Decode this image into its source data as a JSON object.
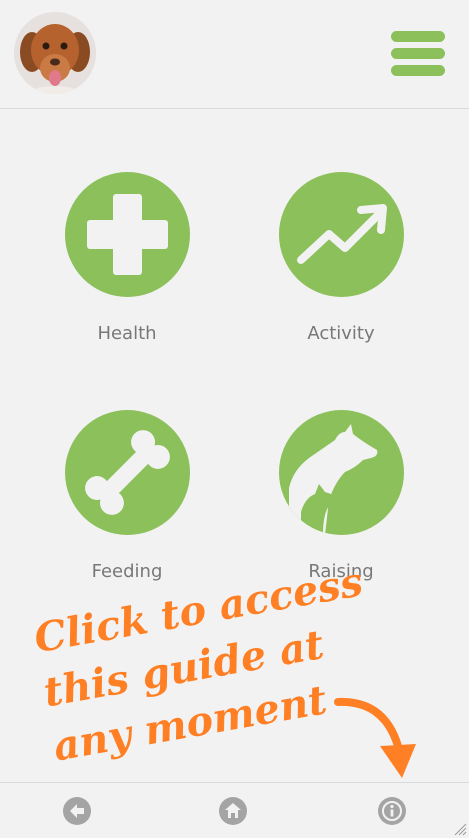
{
  "header": {
    "avatar_icon": "dog-avatar",
    "menu_icon": "hamburger-menu-icon"
  },
  "tiles": [
    {
      "label": "Health",
      "icon": "cross-icon"
    },
    {
      "label": "Activity",
      "icon": "trend-up-icon"
    },
    {
      "label": "Feeding",
      "icon": "bone-icon"
    },
    {
      "label": "Raising",
      "icon": "dog-and-puppy-icon"
    }
  ],
  "guide": {
    "lines": [
      "Click to access",
      "this guide at",
      "any moment"
    ],
    "color": "#ff7f24"
  },
  "footer": {
    "back_icon": "back-arrow-icon",
    "home_icon": "home-icon",
    "info_icon": "info-icon"
  },
  "colors": {
    "accent": "#8bc05a",
    "background": "#f2f2f2",
    "label": "#787878",
    "footer_icon": "#a4a4a4"
  }
}
